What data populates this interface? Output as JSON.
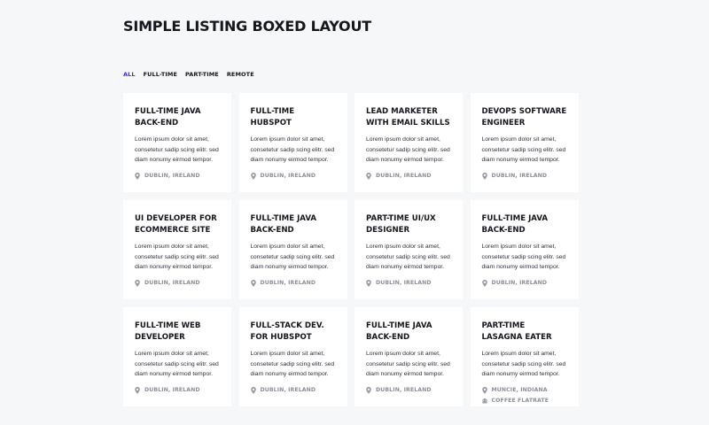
{
  "page": {
    "title": "SIMPLE LISTING BOXED LAYOUT"
  },
  "filters": [
    {
      "label": "ALL",
      "active": true
    },
    {
      "label": "FULL-TIME",
      "active": false
    },
    {
      "label": "PART-TIME",
      "active": false
    },
    {
      "label": "REMOTE",
      "active": false
    }
  ],
  "colors": {
    "accent": "#3b2fd6",
    "background": "#f6f7f9",
    "card": "#ffffff",
    "muted": "#8b8f99"
  },
  "cards": [
    {
      "title": "FULL-TIME JAVA BACK-END DEVELOPER",
      "desc": "Lorem ipsum dolor sit amet, consetetur sadip scing elitr. sed diam nonumy eirmod tempor.",
      "location": "DUBLIN, IRELAND",
      "location_icon": "location-pin-icon"
    },
    {
      "title": "FULL-TIME HUBSPOT MARKETER",
      "desc": "Lorem ipsum dolor sit amet, consetetur sadip scing elitr. sed diam nonumy eirmod tempor.",
      "location": "DUBLIN, IRELAND",
      "location_icon": "location-pin-icon"
    },
    {
      "title": "LEAD MARKETER WITH EMAIL SKILLS",
      "desc": "Lorem ipsum dolor sit amet, consetetur sadip scing elitr. sed diam nonumy eirmod tempor.",
      "location": "DUBLIN, IRELAND",
      "location_icon": "location-pin-icon"
    },
    {
      "title": "DEVOPS SOFTWARE ENGINEER",
      "desc": "Lorem ipsum dolor sit amet, consetetur sadip scing elitr. sed diam nonumy eirmod tempor.",
      "location": "DUBLIN, IRELAND",
      "location_icon": "location-pin-icon"
    },
    {
      "title": "UI DEVELOPER FOR ECOMMERCE SITE",
      "desc": "Lorem ipsum dolor sit amet, consetetur sadip scing elitr. sed diam nonumy eirmod tempor.",
      "location": "DUBLIN, IRELAND",
      "location_icon": "location-pin-icon"
    },
    {
      "title": "FULL-TIME JAVA BACK-END DEVELOPER",
      "desc": "Lorem ipsum dolor sit amet, consetetur sadip scing elitr. sed diam nonumy eirmod tempor.",
      "location": "DUBLIN, IRELAND",
      "location_icon": "location-pin-icon"
    },
    {
      "title": "PART-TIME UI/UX DESIGNER",
      "desc": "Lorem ipsum dolor sit amet, consetetur sadip scing elitr. sed diam nonumy eirmod tempor.",
      "location": "DUBLIN, IRELAND",
      "location_icon": "location-pin-icon"
    },
    {
      "title": "FULL-TIME JAVA BACK-END DEVELOPER",
      "desc": "Lorem ipsum dolor sit amet, consetetur sadip scing elitr. sed diam nonumy eirmod tempor.",
      "location": "DUBLIN, IRELAND",
      "location_icon": "location-pin-icon"
    },
    {
      "title": "FULL-TIME WEB DEVELOPER",
      "desc": "Lorem ipsum dolor sit amet, consetetur sadip scing elitr. sed diam nonumy eirmod tempor.",
      "location": "DUBLIN, IRELAND",
      "location_icon": "location-pin-icon"
    },
    {
      "title": "FULL-STACK DEV. FOR HUBSPOT",
      "desc": "Lorem ipsum dolor sit amet, consetetur sadip scing elitr. sed diam nonumy eirmod tempor.",
      "location": "DUBLIN, IRELAND",
      "location_icon": "location-pin-icon"
    },
    {
      "title": "FULL-TIME JAVA BACK-END DEVELOPER",
      "desc": "Lorem ipsum dolor sit amet, consetetur sadip scing elitr. sed diam nonumy eirmod tempor.",
      "location": "DUBLIN, IRELAND",
      "location_icon": "location-pin-icon"
    },
    {
      "title": "PART-TIME LASAGNA EATER",
      "desc": "Lorem ipsum dolor sit amet, consetetur sadip scing elitr. sed diam nonumy eirmod tempor.",
      "location": "MUNCIE, INDIANA",
      "location_icon": "location-pin-icon",
      "company": "COFFEE FLATRATE",
      "company_icon": "building-icon"
    }
  ]
}
